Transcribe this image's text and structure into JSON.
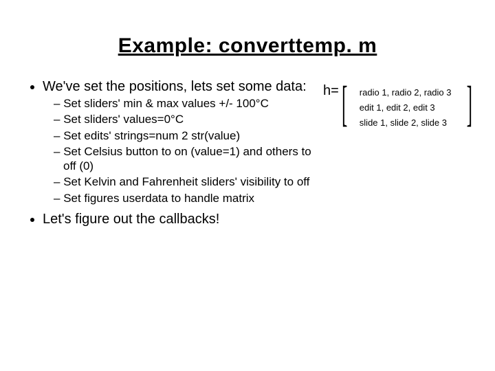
{
  "title": "Example: converttemp. m",
  "bullets": {
    "l1a": "We've set the positions, lets set some data:",
    "sub": [
      "Set sliders' min & max values +/- 100°C",
      "Set sliders' values=0°C",
      "Set edits' strings=num 2 str(value)",
      "Set Celsius button to on (value=1) and others to off (0)",
      "Set Kelvin and Fahrenheit sliders' visibility to off",
      "Set figures userdata to handle matrix"
    ],
    "l1b": "Let's figure out the callbacks!"
  },
  "matrix": {
    "lhs": "h=",
    "rows": [
      "radio 1, radio 2, radio 3",
      "edit 1,  edit 2,  edit 3",
      "slide 1, slide 2, slide 3"
    ],
    "lbracket": "[",
    "rbracket": "]"
  }
}
